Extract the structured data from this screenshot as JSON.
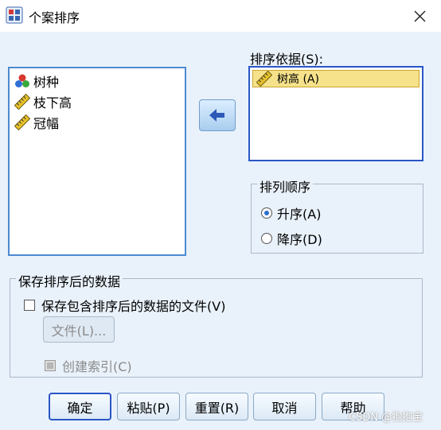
{
  "window": {
    "title": "个案排序"
  },
  "source_variables": [
    {
      "name": "树种",
      "icon": "nominal-variable-icon"
    },
    {
      "name": "枝下高",
      "icon": "scale-variable-icon"
    },
    {
      "name": "冠幅",
      "icon": "scale-variable-icon"
    }
  ],
  "sort_by": {
    "label": "排序依据(S):",
    "items": [
      {
        "name": "树高 (A)",
        "icon": "scale-variable-icon"
      }
    ]
  },
  "sort_order": {
    "legend": "排列顺序",
    "ascending_label": "升序(A)",
    "descending_label": "降序(D)",
    "selected": "ascending"
  },
  "save_section": {
    "legend": "保存排序后的数据",
    "save_file_label": "保存包含排序后的数据的文件(V)",
    "file_button": "文件(L)...",
    "create_index_label": "创建索引(C)"
  },
  "buttons": {
    "ok": "确定",
    "paste": "粘贴(P)",
    "reset": "重置(R)",
    "cancel": "取消",
    "help": "帮助"
  },
  "watermark": "CSDN @抱抱宝",
  "colors": {
    "accent": "#2a56c6",
    "selection": "#f5e28a",
    "dialog_bg": "#e9f1fa"
  }
}
